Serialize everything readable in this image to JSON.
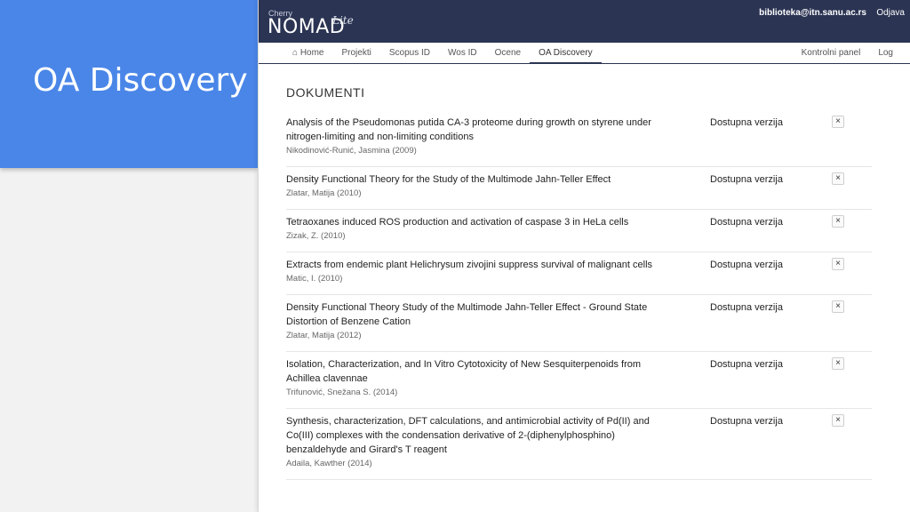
{
  "slide": {
    "title": "OA Discovery"
  },
  "app": {
    "logo": {
      "small": "Cherry",
      "main": "NOMAD",
      "suffix": "Lite"
    },
    "user": {
      "email": "biblioteka@itn.sanu.ac.rs",
      "logout": "Odjava"
    },
    "nav": {
      "left": [
        "⌂ Home",
        "Projekti",
        "Scopus ID",
        "Wos ID",
        "Ocene",
        "OA Discovery"
      ],
      "right": [
        "Kontrolni panel",
        "Log"
      ],
      "active": "OA Discovery"
    },
    "section_title": "DOKUMENTI",
    "documents": [
      {
        "title": "Analysis of the Pseudomonas putida CA-3 proteome during growth on styrene under nitrogen-limiting and non-limiting conditions",
        "author": "Nikodinović-Runić, Jasmina (2009)",
        "status": "Dostupna verzija"
      },
      {
        "title": "Density Functional Theory for the Study of the Multimode Jahn-Teller Effect",
        "author": "Zlatar, Matija (2010)",
        "status": "Dostupna verzija"
      },
      {
        "title": "Tetraoxanes induced ROS production and activation of caspase 3 in HeLa cells",
        "author": "Zizak, Z. (2010)",
        "status": "Dostupna verzija"
      },
      {
        "title": "Extracts from endemic plant Helichrysum zivojini suppress survival of malignant cells",
        "author": "Matic, I. (2010)",
        "status": "Dostupna verzija"
      },
      {
        "title": "Density Functional Theory Study of the Multimode Jahn-Teller Effect - Ground State Distortion of Benzene Cation",
        "author": "Zlatar, Matija (2012)",
        "status": "Dostupna verzija"
      },
      {
        "title": "Isolation, Characterization, and In Vitro Cytotoxicity of New Sesquiterpenoids from Achillea clavennae",
        "author": "Trifunović, Snežana S. (2014)",
        "status": "Dostupna verzija"
      },
      {
        "title": "Synthesis, characterization, DFT calculations, and antimicrobial activity of Pd(II) and Co(III) complexes with the condensation derivative of 2-(diphenylphosphino) benzaldehyde and Girard's T reagent",
        "author": "Adaila, Kawther (2014)",
        "status": "Dostupna verzija"
      }
    ],
    "close_glyph": "×"
  }
}
